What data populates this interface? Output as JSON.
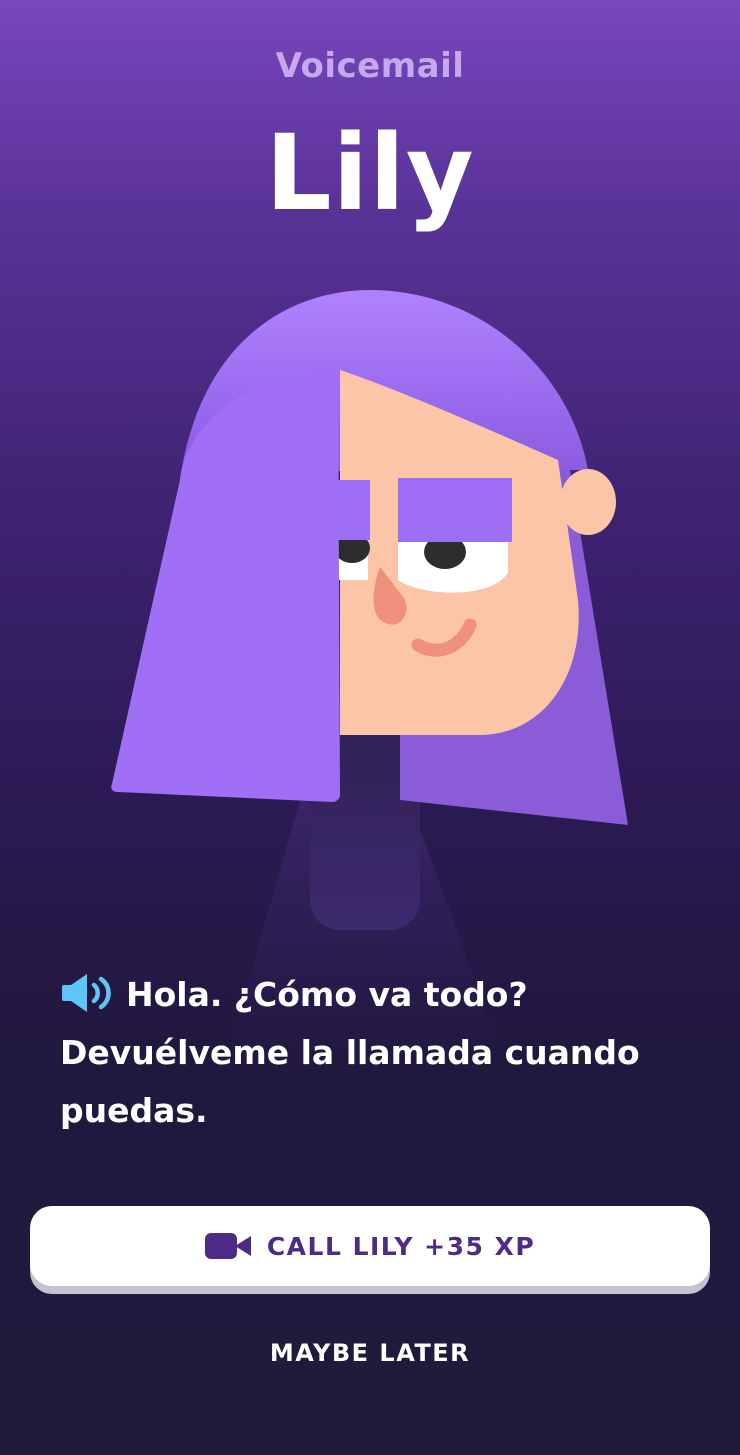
{
  "header": {
    "label": "Voicemail",
    "caller_name": "Lily"
  },
  "message": {
    "icon": "speaker-icon",
    "text": "Hola. ¿Cómo va todo? Devuélveme la llamada cuando puedas."
  },
  "actions": {
    "call_icon": "video-camera-icon",
    "call_label": "CALL LILY +35 XP",
    "later_label": "MAYBE LATER"
  },
  "colors": {
    "background_top": "#7747be",
    "background_bottom": "#1f1a3c",
    "accent": "#4d2b86",
    "speaker_blue": "#5ec6f5",
    "hair": "#9b6ef3",
    "skin": "#fcc5a7"
  }
}
